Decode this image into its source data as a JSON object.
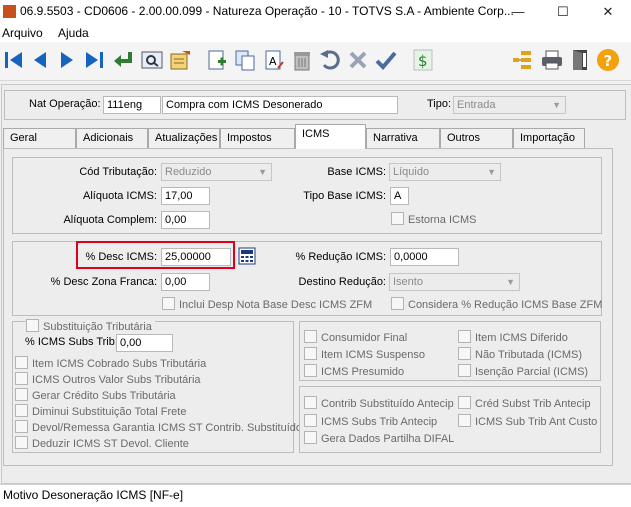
{
  "window": {
    "title": "06.9.5503 - CD0606 - 2.00.00.099 - Natureza Operação - 10 - TOTVS S.A - Ambiente Corp...",
    "minimize": "—",
    "maximize": "☐",
    "close": "✕"
  },
  "menu": {
    "items": [
      "Arquivo",
      "Ajuda"
    ]
  },
  "toolbar": {
    "icons": [
      "first-record",
      "previous-record",
      "next-record",
      "last-record",
      "select-return",
      "search",
      "edit",
      "new",
      "copy",
      "edit-text",
      "delete",
      "undo",
      "cancel",
      "confirm",
      "currency",
      "tree-structure",
      "print",
      "exit",
      "help"
    ]
  },
  "header": {
    "nat_label": "Nat Operação:",
    "nat_code": "111eng",
    "nat_desc": "Compra com ICMS Desonerado",
    "tipo_label": "Tipo:",
    "tipo_value": "Entrada"
  },
  "tabs": [
    "Geral",
    "Adicionais",
    "Atualizações",
    "Impostos",
    "ICMS",
    "Narrativa",
    "Outros",
    "Importação"
  ],
  "icms": {
    "cod_trib_label": "Cód Tributação:",
    "cod_trib_value": "Reduzido",
    "base_icms_label": "Base ICMS:",
    "base_icms_value": "Líquido",
    "aliquota_label": "Alíquota ICMS:",
    "aliquota_value": "17,00",
    "tipo_base_label": "Tipo Base ICMS:",
    "tipo_base_value": "A",
    "aliquota_compl_label": "Alíquota Complem:",
    "aliquota_compl_value": "0,00",
    "estorna_label": "Estorna ICMS"
  },
  "desc": {
    "pct_desc_label": "% Desc ICMS:",
    "pct_desc_value": "25,00000",
    "pct_reducao_label": "% Redução ICMS:",
    "pct_reducao_value": "0,0000",
    "zona_franca_label": "% Desc Zona Franca:",
    "zona_franca_value": "0,00",
    "destino_label": "Destino Redução:",
    "destino_value": "Isento",
    "inclui_label": "Inclui Desp Nota Base Desc ICMS ZFM",
    "considera_label": "Considera  % Redução ICMS Base ZFM"
  },
  "subst": {
    "title": "Substituição Tributária",
    "pct_label": "% ICMS Subs Trib:",
    "pct_value": "0,00",
    "checks": [
      "Item ICMS Cobrado Subs Tributária",
      "ICMS Outros Valor Subs Tributária",
      "Gerar Crédito Subs Tributária",
      "Diminui Substituição Total Frete",
      "Devol/Remessa Garantia ICMS ST Contrib. Substituído",
      "Deduzir ICMS ST Devol. Cliente"
    ]
  },
  "right_checks_a": [
    "Consumidor Final",
    "Item ICMS Diferido",
    "Item ICMS Suspenso",
    "Não Tributada (ICMS)",
    "ICMS Presumido",
    "Isenção Parcial (ICMS)"
  ],
  "right_checks_b": [
    "Contrib Substituído Antecip",
    "Créd Subst Trib Antecip",
    "ICMS Subs Trib Antecip",
    "ICMS Sub Trib Ant Custo",
    "Gera Dados Partilha DIFAL"
  ],
  "status": {
    "text": "Motivo Desoneração ICMS [NF-e]"
  },
  "colors": {
    "highlight": "#e0001a",
    "tab_border": "#a9a9a9"
  }
}
